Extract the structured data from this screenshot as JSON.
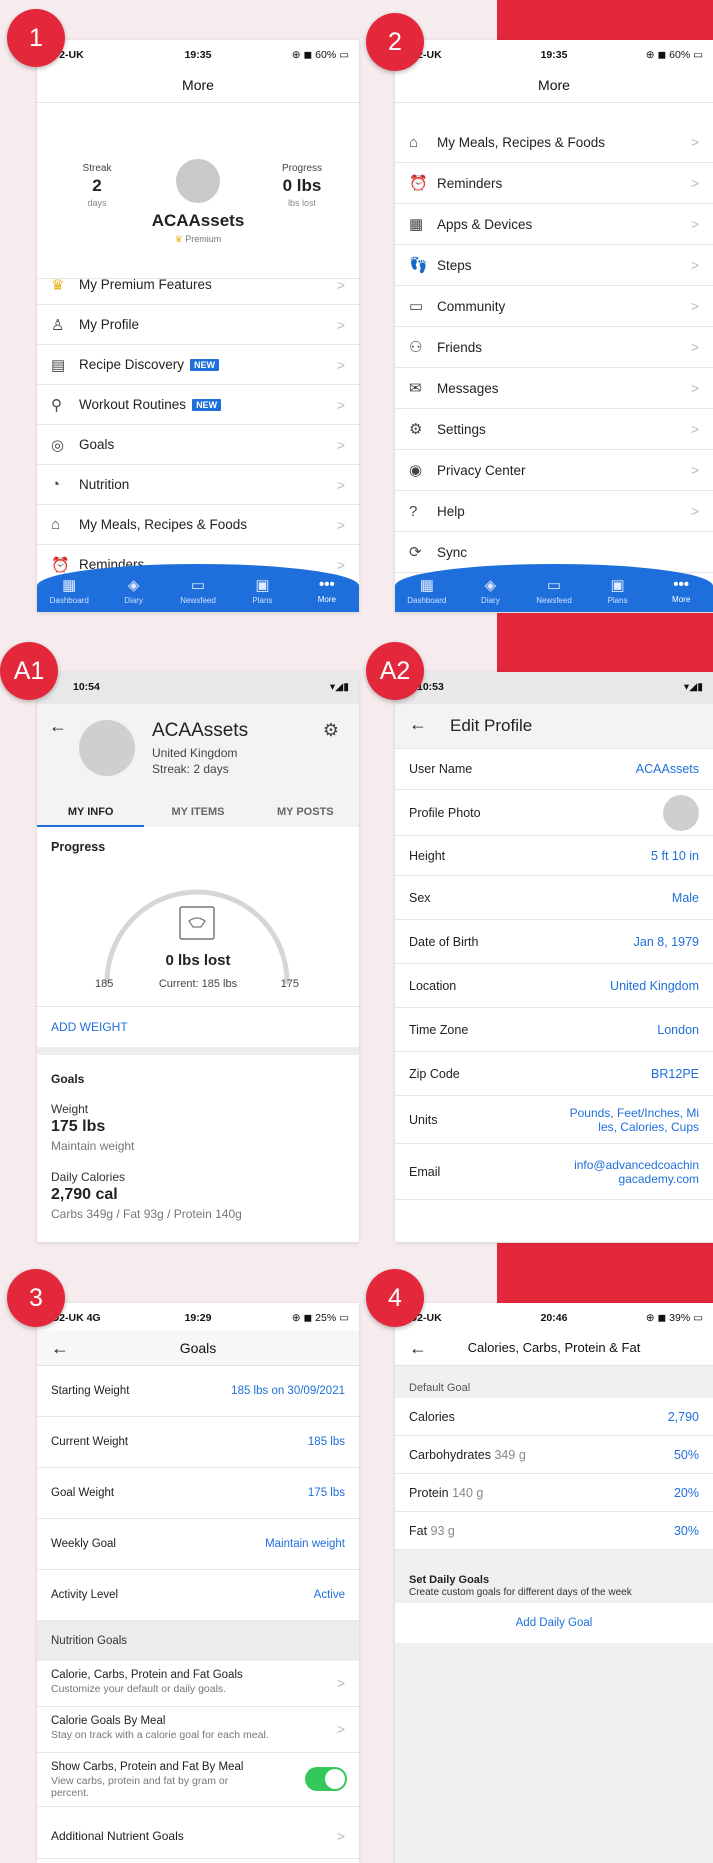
{
  "badges": [
    "1",
    "2",
    "A1",
    "A2",
    "3",
    "4"
  ],
  "panel1": {
    "status": {
      "carrier": "O2-UK",
      "time": "19:35",
      "right": "⊕ ◼ 60% ▭"
    },
    "title": "More",
    "streak": {
      "label": "Streak",
      "value": "2",
      "unit": "days"
    },
    "progress": {
      "label": "Progress",
      "value": "0 lbs",
      "unit": "lbs lost"
    },
    "username": "ACAAssets",
    "premium": "Premium",
    "items": [
      {
        "icon": "crown-icon",
        "glyph": "♛",
        "label": "My Premium Features",
        "new": ""
      },
      {
        "icon": "person-icon",
        "glyph": "♙",
        "label": "My Profile",
        "new": ""
      },
      {
        "icon": "recipe-icon",
        "glyph": "▤",
        "label": "Recipe Discovery",
        "new": "NEW"
      },
      {
        "icon": "dumbbell-icon",
        "glyph": "⚲",
        "label": "Workout Routines",
        "new": "NEW"
      },
      {
        "icon": "target-icon",
        "glyph": "◎",
        "label": "Goals",
        "new": ""
      },
      {
        "icon": "pie-icon",
        "glyph": "◔",
        "label": "Nutrition",
        "new": ""
      },
      {
        "icon": "home-icon",
        "glyph": "⌂",
        "label": "My Meals, Recipes & Foods",
        "new": ""
      },
      {
        "icon": "alarm-icon",
        "glyph": "⏰",
        "label": "Reminders",
        "new": ""
      }
    ]
  },
  "nav": [
    {
      "icon": "dashboard-icon",
      "glyph": "▦",
      "label": "Dashboard"
    },
    {
      "icon": "diary-icon",
      "glyph": "◈",
      "label": "Diary"
    },
    {
      "icon": "newsfeed-icon",
      "glyph": "▭",
      "label": "Newsfeed"
    },
    {
      "icon": "plans-icon",
      "glyph": "▣",
      "label": "Plans"
    },
    {
      "icon": "more-icon",
      "glyph": "•••",
      "label": "More"
    }
  ],
  "panel2": {
    "status": {
      "carrier": "O2-UK",
      "time": "19:35",
      "right": "⊕ ◼ 60% ▭"
    },
    "title": "More",
    "items": [
      {
        "icon": "home-icon",
        "glyph": "⌂",
        "label": "My Meals, Recipes & Foods"
      },
      {
        "icon": "alarm-icon",
        "glyph": "⏰",
        "label": "Reminders"
      },
      {
        "icon": "apps-icon",
        "glyph": "▦",
        "label": "Apps & Devices"
      },
      {
        "icon": "steps-icon",
        "glyph": "👣",
        "label": "Steps"
      },
      {
        "icon": "community-icon",
        "glyph": "▭",
        "label": "Community"
      },
      {
        "icon": "friends-icon",
        "glyph": "⚇",
        "label": "Friends"
      },
      {
        "icon": "mail-icon",
        "glyph": "✉",
        "label": "Messages"
      },
      {
        "icon": "gear-icon",
        "glyph": "⚙",
        "label": "Settings"
      },
      {
        "icon": "privacy-icon",
        "glyph": "◉",
        "label": "Privacy Center"
      },
      {
        "icon": "help-icon",
        "glyph": "?",
        "label": "Help"
      },
      {
        "icon": "sync-icon",
        "glyph": "⟳",
        "label": "Sync"
      }
    ]
  },
  "panelA1": {
    "status": {
      "time": "10:54",
      "right": "▾◢▮"
    },
    "username": "ACAAssets",
    "country": "United Kingdom",
    "streak": "Streak: 2 days",
    "tabs": [
      "MY INFO",
      "MY ITEMS",
      "MY POSTS"
    ],
    "progress_title": "Progress",
    "lost": "0 lbs lost",
    "start": "185",
    "current": "Current: 185 lbs",
    "goal": "175",
    "gauge_fraction": 0,
    "add_weight": "ADD WEIGHT",
    "goals_title": "Goals",
    "weight_label": "Weight",
    "weight_value": "175 lbs",
    "weight_sub": "Maintain weight",
    "cal_label": "Daily Calories",
    "cal_value": "2,790 cal",
    "cal_sub": "Carbs 349g / Fat 93g / Protein 140g"
  },
  "panelA2": {
    "status": {
      "time": "10:53",
      "right": "▾◢▮"
    },
    "title": "Edit Profile",
    "rows": [
      {
        "label": "User Name",
        "value": "ACAAssets"
      },
      {
        "label": "Profile Photo",
        "value": ""
      },
      {
        "label": "Height",
        "value": "5 ft 10 in"
      },
      {
        "label": "Sex",
        "value": "Male"
      },
      {
        "label": "Date of Birth",
        "value": "Jan 8, 1979"
      },
      {
        "label": "Location",
        "value": "United Kingdom"
      },
      {
        "label": "Time Zone",
        "value": "London"
      },
      {
        "label": "Zip Code",
        "value": "BR12PE"
      },
      {
        "label": "Units",
        "value": "Pounds, Feet/Inches, Miles, Calories, Cups"
      },
      {
        "label": "Email",
        "value": "info@advancedcoachingacademy.com"
      }
    ]
  },
  "panel3": {
    "status": {
      "carrier": "O2-UK 4G",
      "time": "19:29",
      "right": "⊕ ◼ 25% ▭"
    },
    "title": "Goals",
    "rows": [
      {
        "label": "Starting Weight",
        "value": "185 lbs on 30/09/2021"
      },
      {
        "label": "Current Weight",
        "value": "185 lbs"
      },
      {
        "label": "Goal Weight",
        "value": "175 lbs"
      },
      {
        "label": "Weekly Goal",
        "value": "Maintain weight"
      },
      {
        "label": "Activity Level",
        "value": "Active"
      }
    ],
    "section": "Nutrition Goals",
    "nutri": [
      {
        "title": "Calorie, Carbs, Protein and Fat Goals",
        "sub": "Customize your default or daily goals."
      },
      {
        "title": "Calorie Goals By Meal",
        "sub": "Stay on track with a calorie goal for each meal."
      },
      {
        "title": "Show Carbs, Protein and Fat By Meal",
        "sub": "View carbs, protein and fat by gram or percent."
      }
    ],
    "additional": "Additional Nutrient Goals"
  },
  "panel4": {
    "status": {
      "carrier": "O2-UK",
      "time": "20:46",
      "right": "⊕ ◼ 39% ▭"
    },
    "title": "Calories, Carbs, Protein & Fat",
    "section": "Default Goal",
    "rows": [
      {
        "label": "Calories",
        "grams": "",
        "value": "2,790"
      },
      {
        "label": "Carbohydrates",
        "grams": "349 g",
        "value": "50%"
      },
      {
        "label": "Protein",
        "grams": "140 g",
        "value": "20%"
      },
      {
        "label": "Fat",
        "grams": "93 g",
        "value": "30%"
      }
    ],
    "daily_title": "Set Daily Goals",
    "daily_sub": "Create custom goals for different days of the week",
    "add_daily": "Add Daily Goal"
  },
  "colors": {
    "accent": "#1e6fdb",
    "badge": "#e3283c",
    "toggle": "#34c759"
  }
}
